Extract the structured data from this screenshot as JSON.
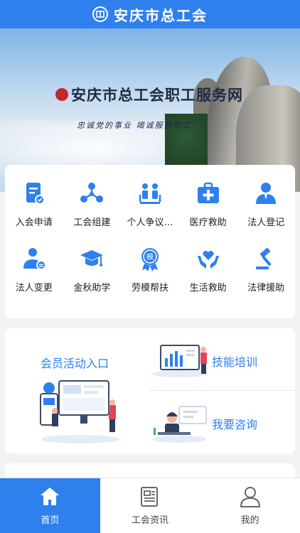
{
  "header": {
    "title": "安庆市总工会",
    "logo_icon": "union-emblem-icon"
  },
  "banner": {
    "brand_text": "安庆市总工会职工服务网",
    "slogan": "忠诚党的事业  竭诚服务职工"
  },
  "services": [
    {
      "label": "入会申请",
      "icon": "application-form-icon"
    },
    {
      "label": "工会组建",
      "icon": "network-nodes-icon"
    },
    {
      "label": "个人争议…",
      "icon": "people-dispute-icon"
    },
    {
      "label": "医疗救助",
      "icon": "medical-kit-icon"
    },
    {
      "label": "法人登记",
      "icon": "person-register-icon"
    },
    {
      "label": "法人变更",
      "icon": "person-change-icon"
    },
    {
      "label": "金秋助学",
      "icon": "graduation-cap-icon"
    },
    {
      "label": "劳模帮扶",
      "icon": "model-badge-icon"
    },
    {
      "label": "生活救助",
      "icon": "heart-hands-icon"
    },
    {
      "label": "法律援助",
      "icon": "gavel-icon"
    }
  ],
  "promo": {
    "member_activity": "会员活动入口",
    "skills_training": "技能培训",
    "consult": "我要咨询"
  },
  "tabs": [
    {
      "label": "首页",
      "icon": "home-icon",
      "active": true
    },
    {
      "label": "工会资讯",
      "icon": "news-icon",
      "active": false
    },
    {
      "label": "我的",
      "icon": "user-icon",
      "active": false
    }
  ],
  "colors": {
    "primary": "#2f80ed",
    "background": "#f2f3f5"
  }
}
